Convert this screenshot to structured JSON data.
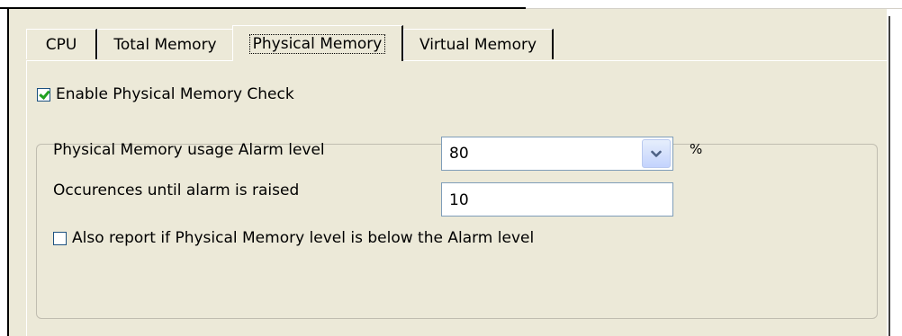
{
  "tabs": [
    {
      "label": "CPU"
    },
    {
      "label": "Total Memory"
    },
    {
      "label": "Physical Memory",
      "selected": true
    },
    {
      "label": "Virtual Memory"
    }
  ],
  "enable_check": {
    "label": "Enable Physical Memory Check",
    "checked": true
  },
  "alarm": {
    "label": "Physical Memory usage Alarm level",
    "value": "80",
    "unit": "%"
  },
  "occurrences": {
    "label": "Occurences until alarm is raised",
    "value": "10"
  },
  "report_check": {
    "label": "Also report if Physical Memory level is below the Alarm level",
    "checked": false
  },
  "icons": {
    "dropdown": "chevron-down-icon",
    "checkmark": "checkmark-icon"
  },
  "colors": {
    "dialog_bg": "#ece9d8",
    "field_border": "#7f9db9",
    "checkmark": "#21a121"
  }
}
